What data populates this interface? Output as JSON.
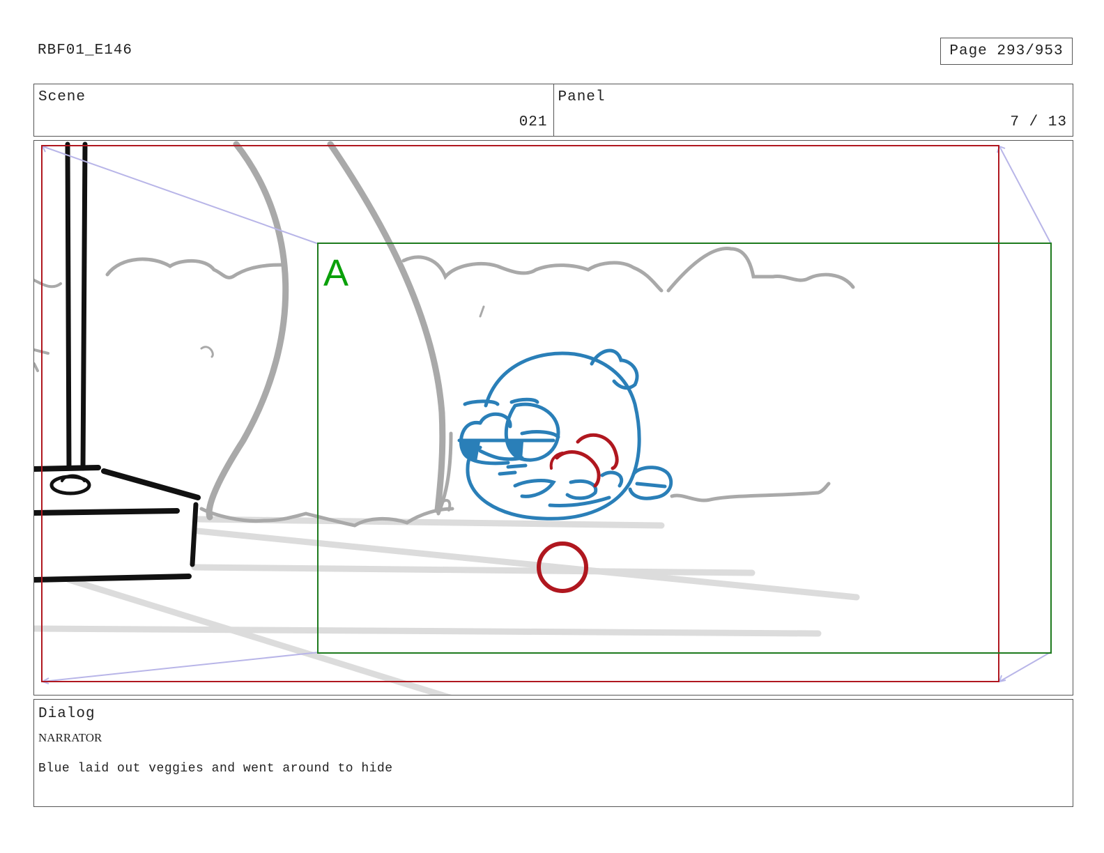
{
  "header": {
    "doc_id": "RBF01_E146",
    "page_label": "Page 293/953"
  },
  "info": {
    "scene_label": "Scene",
    "scene_value": "021",
    "panel_label": "Panel",
    "panel_value": "7 / 13"
  },
  "panel": {
    "camera_label": "A",
    "colors": {
      "frame_red": "#b0171f",
      "frame_green": "#1d7a1d",
      "camera_label_green": "#0aa00a",
      "character_blue": "#2a7fb8",
      "veggie_red": "#b0171f",
      "background_gray": "#ababab",
      "floor_gray": "#dddddd",
      "pole_black": "#111111",
      "arrow_purple": "#b3b0e6"
    }
  },
  "dialog": {
    "label": "Dialog",
    "speaker": "NARRATOR",
    "line": "Blue laid out veggies and went around to hide"
  }
}
